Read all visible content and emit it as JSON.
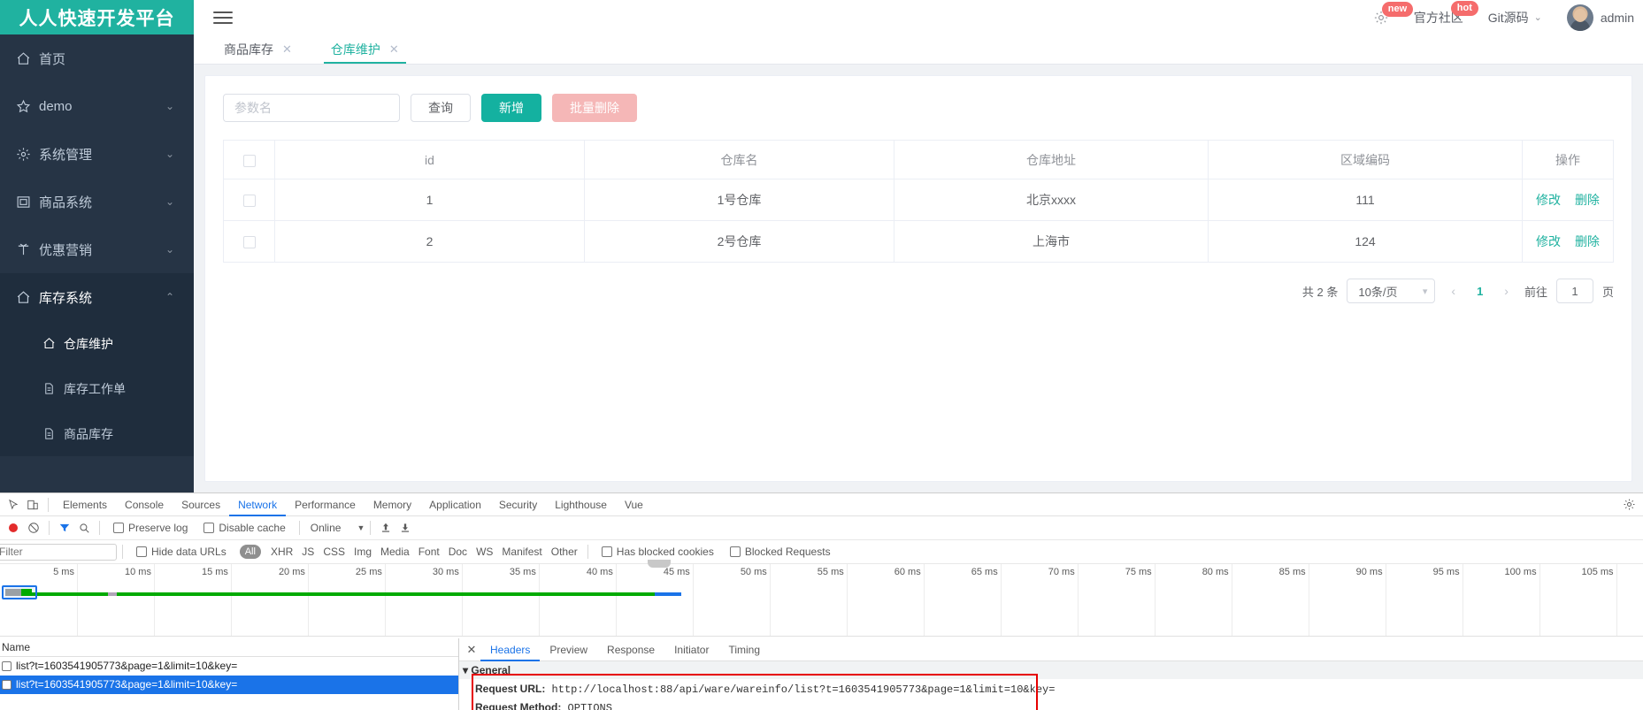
{
  "app": {
    "logo_text": "人人快速开发平台",
    "accent": "#20b2a0",
    "sidebar_bg": "#263445"
  },
  "sidebar": {
    "items": [
      {
        "label": "首页",
        "icon": "home-icon",
        "arrow": "",
        "expanded": false,
        "active": false
      },
      {
        "label": "demo",
        "icon": "star-icon",
        "arrow": "⌄",
        "expanded": false,
        "active": false
      },
      {
        "label": "系统管理",
        "icon": "gear-icon",
        "arrow": "⌄",
        "expanded": false,
        "active": false
      },
      {
        "label": "商品系统",
        "icon": "box-icon",
        "arrow": "⌄",
        "expanded": false,
        "active": false
      },
      {
        "label": "优惠营销",
        "icon": "tag-icon",
        "arrow": "⌄",
        "expanded": false,
        "active": false
      },
      {
        "label": "库存系统",
        "icon": "home-icon",
        "arrow": "⌃",
        "expanded": true,
        "active": false
      }
    ],
    "subitems": [
      {
        "label": "仓库维护",
        "icon": "home-icon",
        "active": true
      },
      {
        "label": "库存工作单",
        "icon": "doc-icon",
        "active": false
      },
      {
        "label": "商品库存",
        "icon": "doc-icon",
        "active": false
      }
    ]
  },
  "header": {
    "hamburger": "menu-icon",
    "gear": "gear-icon",
    "badge_new": "new",
    "badge_hot": "hot",
    "community_label": "官方社区",
    "git_label": "Git源码",
    "git_caret": "⌄",
    "username": "admin",
    "badge_color": "#f56c6c"
  },
  "tabs": [
    {
      "label": "商品库存",
      "active": false,
      "close": "✕"
    },
    {
      "label": "仓库维护",
      "active": true,
      "close": "✕"
    }
  ],
  "toolbar": {
    "search_placeholder": "参数名",
    "search_value": "",
    "query_label": "查询",
    "add_label": "新增",
    "batch_delete_label": "批量删除"
  },
  "table": {
    "columns": [
      "",
      "id",
      "仓库名",
      "仓库地址",
      "区域编码",
      "操作"
    ],
    "rows": [
      {
        "id": "1",
        "name": "1号仓库",
        "address": "北京xxxx",
        "code": "111",
        "edit": "修改",
        "delete": "删除"
      },
      {
        "id": "2",
        "name": "2号仓库",
        "address": "上海市",
        "code": "124",
        "edit": "修改",
        "delete": "删除"
      }
    ]
  },
  "pagination": {
    "total_label": "共 2 条",
    "page_size": "10条/页",
    "prev": "‹",
    "current_page": "1",
    "next": "›",
    "jump_label": "前往",
    "jump_value": "1",
    "jump_suffix": "页"
  },
  "devtools": {
    "panels": [
      "Elements",
      "Console",
      "Sources",
      "Network",
      "Performance",
      "Memory",
      "Application",
      "Security",
      "Lighthouse",
      "Vue"
    ],
    "active_panel": "Network",
    "toolbar": {
      "preserve_log": "Preserve log",
      "disable_cache": "Disable cache",
      "throttle": "Online",
      "throttle_caret": "▼"
    },
    "filterbar": {
      "filter_placeholder": "Filter",
      "hide_data_urls": "Hide data URLs",
      "all_pill": "All",
      "types": [
        "XHR",
        "JS",
        "CSS",
        "Img",
        "Media",
        "Font",
        "Doc",
        "WS",
        "Manifest",
        "Other"
      ],
      "has_blocked_cookies": "Has blocked cookies",
      "blocked_requests": "Blocked Requests"
    },
    "timeline_ticks": [
      "5 ms",
      "10 ms",
      "15 ms",
      "20 ms",
      "25 ms",
      "30 ms",
      "35 ms",
      "40 ms",
      "45 ms",
      "50 ms",
      "55 ms",
      "60 ms",
      "65 ms",
      "70 ms",
      "75 ms",
      "80 ms",
      "85 ms",
      "90 ms",
      "95 ms",
      "100 ms",
      "105 ms"
    ],
    "requests_header": "Name",
    "requests": [
      {
        "name": "list?t=1603541905773&page=1&limit=10&key=",
        "selected": false
      },
      {
        "name": "list?t=1603541905773&page=1&limit=10&key=",
        "selected": true
      }
    ],
    "detail_tabs": [
      "Headers",
      "Preview",
      "Response",
      "Initiator",
      "Timing"
    ],
    "detail_active": "Headers",
    "detail_close": "✕",
    "general_section": "General",
    "request_url_key": "Request URL:",
    "request_url_value": "http://localhost:88/api/ware/wareinfo/list?t=1603541905773&page=1&limit=10&key=",
    "request_method_key": "Request Method:",
    "request_method_value": "OPTIONS",
    "highlight_color": "#e60000"
  }
}
